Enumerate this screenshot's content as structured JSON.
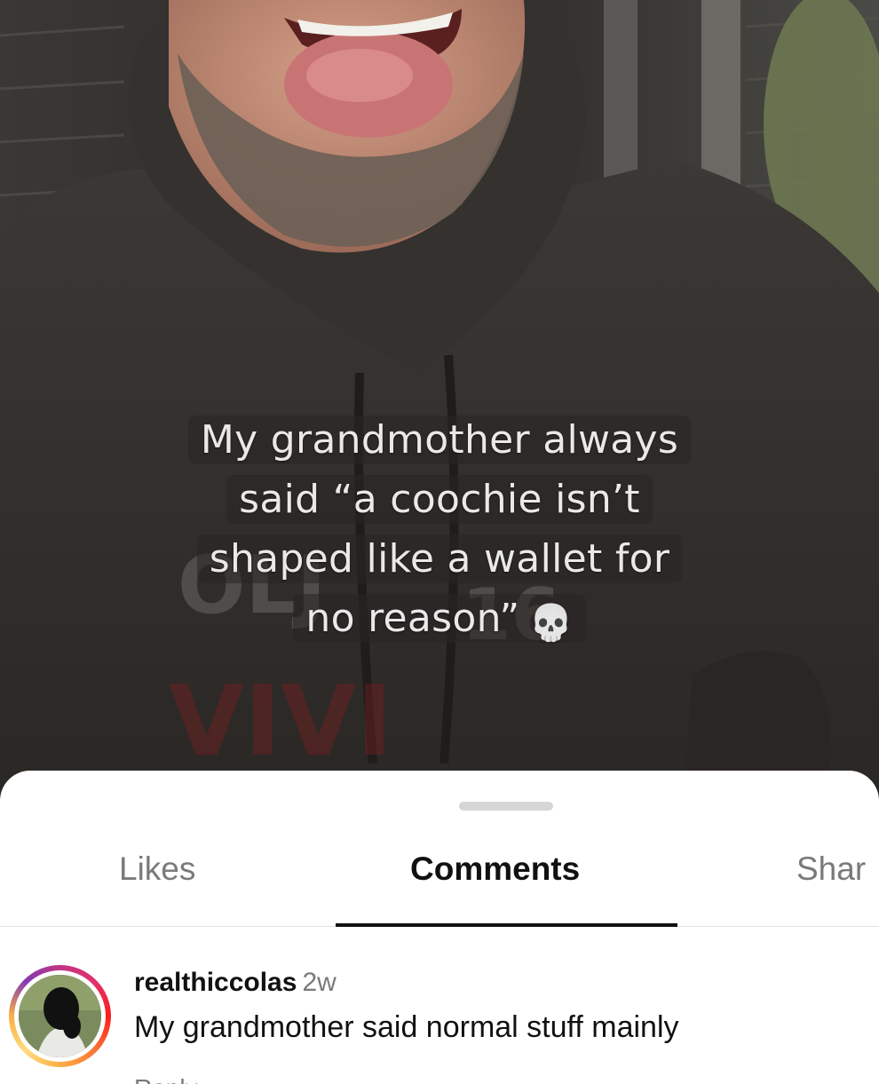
{
  "video": {
    "caption_lines": [
      "My grandmother always",
      "said “a coochie isn’t",
      "shaped like a wallet for",
      "no reason”"
    ],
    "caption_emoji": "💀"
  },
  "sheet": {
    "tabs": [
      {
        "label": "Likes",
        "active": false
      },
      {
        "label": "Comments",
        "active": true
      },
      {
        "label": "Shar",
        "active": false
      }
    ]
  },
  "comments": [
    {
      "username": "realthiccolas",
      "timestamp": "2w",
      "text": "My grandmother said normal stuff mainly",
      "reply_label": "Reply"
    }
  ],
  "colors": {
    "active_tab": "#111111",
    "inactive_tab": "#7a7a7a",
    "avatar_ring": "#e1306c"
  }
}
